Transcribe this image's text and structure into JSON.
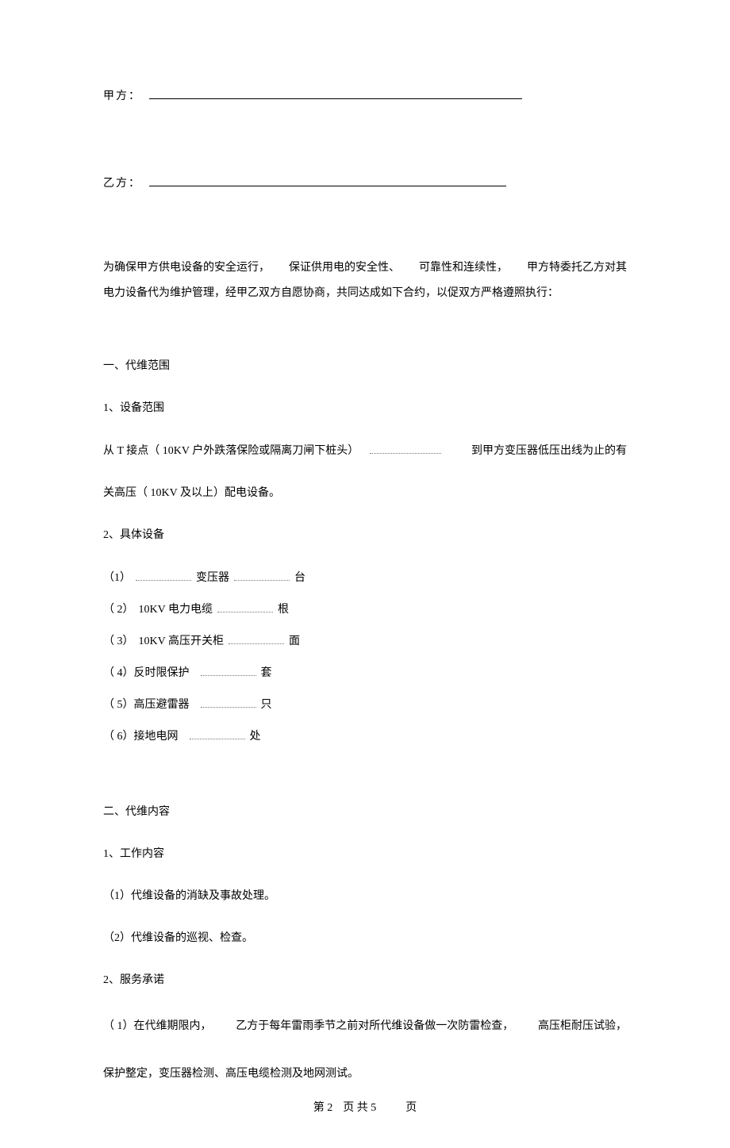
{
  "parties": {
    "a_label": "甲方：",
    "b_label": "乙方："
  },
  "intro": {
    "line1_parts": [
      "为确保甲方供电设备的安全运行，",
      "保证供用电的安全性、",
      "可靠性和连续性，",
      "甲方特委托乙方对其"
    ],
    "line2": "电力设备代为维护管理，经甲乙双方自愿协商，共同达成如下合约，以促双方严格遵照执行："
  },
  "s1": {
    "title": "一、代维范围",
    "p1": "1、设备范围",
    "p1desc_a": "从 T 接点（ 10KV 户外跌落保险或隔离刀闸下桩头）",
    "p1desc_b": "到甲方变压器低压出线为止的有",
    "p1desc_c": "关高压（ 10KV 及以上）配电设备。",
    "p2": "2、具体设备",
    "items": [
      {
        "prefix": "（1）",
        "name": "变压器",
        "unit": "台",
        "blank1_w": "w70",
        "blank2_w": "w70",
        "two_blanks": true
      },
      {
        "prefix": "（ 2）",
        "name": "10KV 电力电缆",
        "unit": "根",
        "blank1_w": "w70",
        "two_blanks": false
      },
      {
        "prefix": "（ 3）",
        "name": "10KV 高压开关柜",
        "unit": "面",
        "blank1_w": "w70",
        "two_blanks": false
      },
      {
        "prefix": "（ 4）",
        "name": "反时限保护",
        "unit": "套",
        "blank1_w": "w70",
        "two_blanks": false,
        "gap": true
      },
      {
        "prefix": "（ 5）",
        "name": "高压避雷器",
        "unit": "只",
        "blank1_w": "w70",
        "two_blanks": false,
        "gap": true
      },
      {
        "prefix": "（ 6）",
        "name": "接地电网",
        "unit": "处",
        "blank1_w": "w70",
        "two_blanks": false,
        "gap": true
      }
    ]
  },
  "s2": {
    "title": "二、代维内容",
    "p1": "1、工作内容",
    "items1": [
      "（1）代维设备的消缺及事故处理。",
      "（2）代维设备的巡视、检查。"
    ],
    "p2": "2、服务承诺",
    "item2_line1_parts": [
      "（ 1）在代维期限内，",
      "乙方于每年雷雨季节之前对所代维设备做一次防雷检查，",
      "高压柜耐压试验，"
    ],
    "item2_line2": "保护整定，变压器检测、高压电缆检测及地网测试。"
  },
  "footer": {
    "left": "第 2",
    "mid": "页 共 5",
    "right": "页"
  }
}
